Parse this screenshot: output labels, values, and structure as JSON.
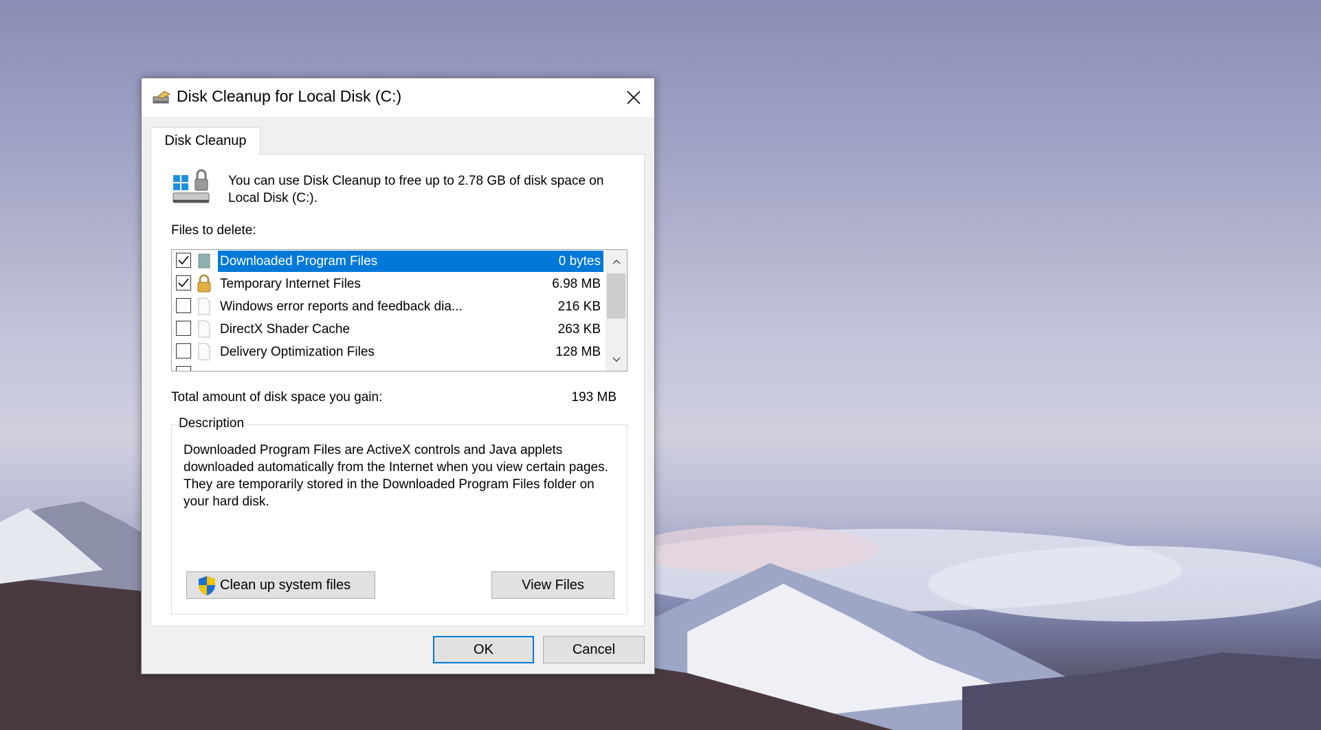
{
  "window": {
    "title": "Disk Cleanup for Local Disk (C:)"
  },
  "tab": {
    "label": "Disk Cleanup"
  },
  "intro": {
    "text": "You can use Disk Cleanup to free up to 2.78 GB of disk space on Local Disk (C:)."
  },
  "files_to_delete": {
    "label": "Files to delete:",
    "items": [
      {
        "name": "Downloaded Program Files",
        "size": "0 bytes",
        "checked": true,
        "selected": true,
        "icon": "folder-icon"
      },
      {
        "name": "Temporary Internet Files",
        "size": "6.98 MB",
        "checked": true,
        "selected": false,
        "icon": "lock-icon"
      },
      {
        "name": "Windows error reports and feedback dia...",
        "size": "216 KB",
        "checked": false,
        "selected": false,
        "icon": "file-icon"
      },
      {
        "name": "DirectX Shader Cache",
        "size": "263 KB",
        "checked": false,
        "selected": false,
        "icon": "file-icon"
      },
      {
        "name": "Delivery Optimization Files",
        "size": "128 MB",
        "checked": false,
        "selected": false,
        "icon": "file-icon"
      }
    ]
  },
  "total": {
    "label": "Total amount of disk space you gain:",
    "value": "193 MB"
  },
  "description": {
    "legend": "Description",
    "text": "Downloaded Program Files are ActiveX controls and Java applets downloaded automatically from the Internet when you view certain pages. They are temporarily stored in the Downloaded Program Files folder on your hard disk."
  },
  "buttons": {
    "cleanup_system": "Clean up system files",
    "view_files": "View Files",
    "ok": "OK",
    "cancel": "Cancel"
  },
  "colors": {
    "selection": "#0078d7",
    "dialog_bg": "#f0f0f0"
  }
}
